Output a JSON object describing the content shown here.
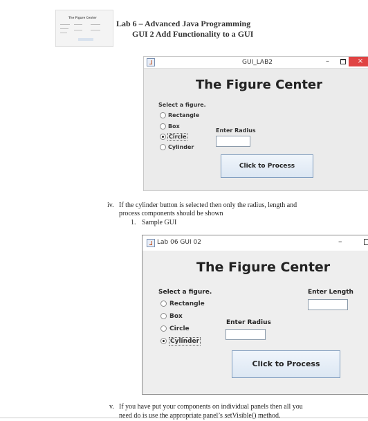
{
  "header": {
    "line1": "Lab 6 – Advanced Java Programming",
    "line2": "GUI 2 Add Functionality to a GUI",
    "thumbnail_title": "The Figure Center"
  },
  "window1": {
    "title": "GUI_LAB2",
    "heading": "The Figure Center",
    "select_label": "Select a figure.",
    "options": [
      "Rectangle",
      "Box",
      "Circle",
      "Cylinder"
    ],
    "selected": "Circle",
    "radius_label": "Enter Radius",
    "radius_value": "",
    "button": "Click to Process",
    "minimize": "–",
    "close": "×"
  },
  "item_iv": {
    "number": "iv.",
    "text_line1": "If the cylinder button is selected then only the radius, length and",
    "text_line2": "process components should be shown",
    "sub_number": "1.",
    "sub_text": "Sample GUI"
  },
  "window2": {
    "title": "Lab 06 GUI 02",
    "heading": "The Figure Center",
    "select_label": "Select a figure.",
    "options": [
      "Rectangle",
      "Box",
      "Circle",
      "Cylinder"
    ],
    "selected": "Cylinder",
    "radius_label": "Enter Radius",
    "length_label": "Enter Length",
    "radius_value": "",
    "length_value": "",
    "button": "Click to Process",
    "minimize": "–"
  },
  "item_v": {
    "number": "v.",
    "text_line1": "If you have put your components on individual panels then all you",
    "text_line2": "need do is use the appropriate panel’s setVisible() method."
  }
}
